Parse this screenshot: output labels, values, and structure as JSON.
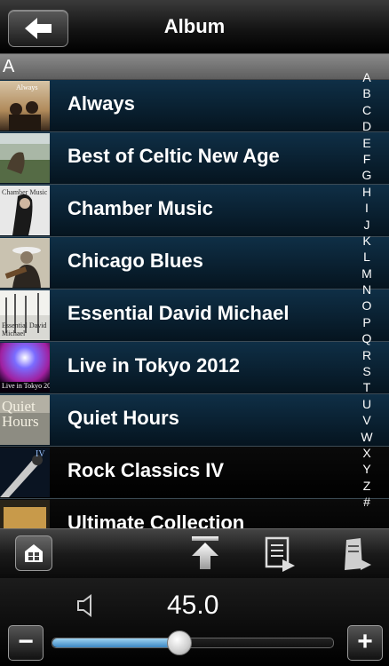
{
  "header": {
    "title": "Album",
    "back_icon": "arrow-left-icon"
  },
  "section_letter": "A",
  "albums": [
    {
      "title": "Always",
      "cover_text": "Always"
    },
    {
      "title": "Best of Celtic New Age",
      "cover_text": ""
    },
    {
      "title": "Chamber Music",
      "cover_text": "Chamber Music"
    },
    {
      "title": "Chicago Blues",
      "cover_text": ""
    },
    {
      "title": "Essential David Michael",
      "cover_text": "Essential David Michael"
    },
    {
      "title": "Live in Tokyo 2012",
      "cover_text": "Live in Tokyo 2012"
    },
    {
      "title": "Quiet Hours",
      "cover_text": "Quiet Hours"
    },
    {
      "title": "Rock Classics IV",
      "cover_text": "IV"
    },
    {
      "title": "Ultimate Collection",
      "cover_text": ""
    }
  ],
  "index_letters": [
    "A",
    "B",
    "C",
    "D",
    "E",
    "F",
    "G",
    "H",
    "I",
    "J",
    "K",
    "L",
    "M",
    "N",
    "O",
    "P",
    "Q",
    "R",
    "S",
    "T",
    "U",
    "V",
    "W",
    "X",
    "Y",
    "Z",
    "#"
  ],
  "toolbar": {
    "icons": [
      "home-icon",
      "scroll-top-icon",
      "now-playing-list-icon",
      "media-server-icon"
    ]
  },
  "volume": {
    "value": "45.0",
    "level_fraction": 0.45,
    "minus_label": "−",
    "plus_label": "+"
  },
  "colors": {
    "accent": "#3b86c2",
    "row_gradient_top": "#0f2f46"
  }
}
